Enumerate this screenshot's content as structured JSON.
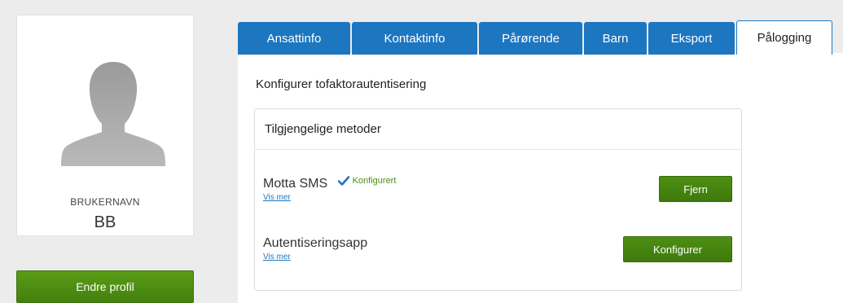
{
  "profile": {
    "username_label": "BRUKERNAVN",
    "username": "BB",
    "edit_button": "Endre profil"
  },
  "tabs": [
    {
      "label": "Ansattinfo",
      "active": false
    },
    {
      "label": "Kontaktinfo",
      "active": false
    },
    {
      "label": "Pårørende",
      "active": false
    },
    {
      "label": "Barn",
      "active": false
    },
    {
      "label": "Eksport",
      "active": false
    },
    {
      "label": "Pålogging",
      "active": true
    }
  ],
  "section": {
    "title": "Konfigurer tofaktorautentisering",
    "methods_header": "Tilgjengelige metoder",
    "methods": [
      {
        "name": "Motta SMS",
        "status": "Konfigurert",
        "more_link": "Vis mer",
        "button": "Fjern"
      },
      {
        "name": "Autentiseringsapp",
        "status": "",
        "more_link": "Vis mer",
        "button": "Konfigurer"
      }
    ]
  },
  "colors": {
    "tab_blue": "#1c76c0",
    "button_green": "#4e8d12",
    "status_green": "#4e8d12",
    "background": "#ececec"
  }
}
